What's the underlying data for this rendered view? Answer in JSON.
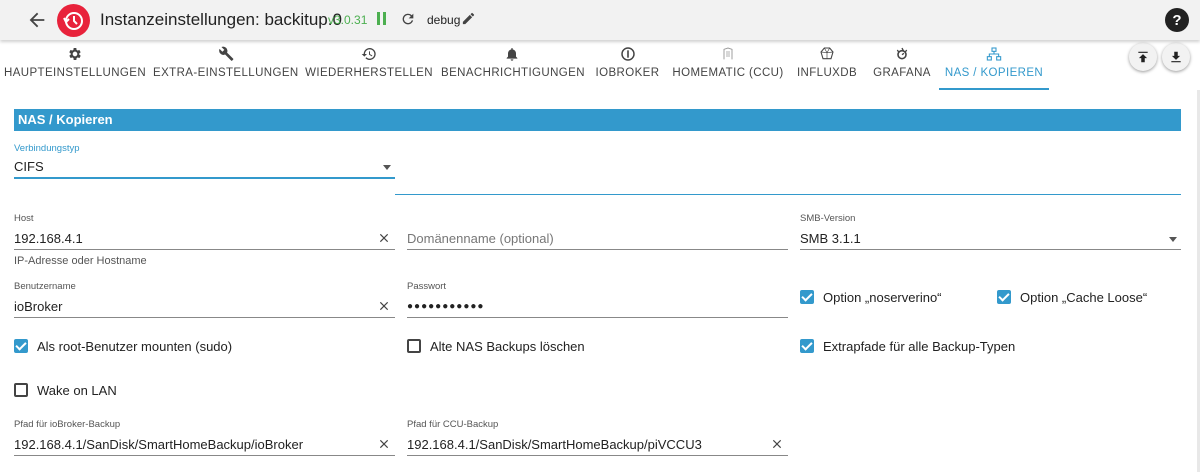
{
  "header": {
    "title": "Instanzeinstellungen: backitup.0",
    "version": "v3.0.31",
    "log_level": "debug",
    "help": "?",
    "accent": "#3399cc",
    "logo_color": "#e8223b"
  },
  "tabs": [
    {
      "label": "HAUPTEINSTELLUNGEN",
      "icon": "gear-icon"
    },
    {
      "label": "EXTRA-EINSTELLUNGEN",
      "icon": "wrench-icon"
    },
    {
      "label": "WIEDERHERSTELLEN",
      "icon": "restore-icon"
    },
    {
      "label": "BENACHRICHTIGUNGEN",
      "icon": "bell-icon"
    },
    {
      "label": "IOBROKER",
      "icon": "iobroker-icon"
    },
    {
      "label": "HOMEMATIC (CCU)",
      "icon": "homematic-icon"
    },
    {
      "label": "INFLUXDB",
      "icon": "influxdb-icon"
    },
    {
      "label": "GRAFANA",
      "icon": "grafana-icon"
    },
    {
      "label": "NAS / KOPIEREN",
      "icon": "network-icon",
      "active": true
    }
  ],
  "section": {
    "title": "NAS / Kopieren"
  },
  "form": {
    "connection_type": {
      "label": "Verbindungstyp",
      "value": "CIFS"
    },
    "host": {
      "label": "Host",
      "value": "192.168.4.1",
      "helper": "IP-Adresse oder Hostname"
    },
    "domain": {
      "placeholder": "Domänenname (optional)"
    },
    "smb_version": {
      "label": "SMB-Version",
      "value": "SMB 3.1.1"
    },
    "username": {
      "label": "Benutzername",
      "value": "ioBroker"
    },
    "password": {
      "label": "Passwort",
      "value": "●●●●●●●●●●●"
    },
    "noserverino": {
      "label": "Option „noserverino“",
      "checked": true
    },
    "cache_loose": {
      "label": "Option „Cache Loose“",
      "checked": true
    },
    "sudo": {
      "label": "Als root-Benutzer mounten (sudo)",
      "checked": true
    },
    "delete_old": {
      "label": "Alte NAS Backups löschen",
      "checked": false
    },
    "extra_paths": {
      "label": "Extrapfade für alle Backup-Typen",
      "checked": true
    },
    "wake_on_lan": {
      "label": "Wake on LAN",
      "checked": false
    },
    "iobroker_path": {
      "label": "Pfad für ioBroker-Backup",
      "value": "192.168.4.1/SanDisk/SmartHomeBackup/ioBroker"
    },
    "ccu_path": {
      "label": "Pfad für CCU-Backup",
      "value": "192.168.4.1/SanDisk/SmartHomeBackup/piVCCU3"
    }
  }
}
